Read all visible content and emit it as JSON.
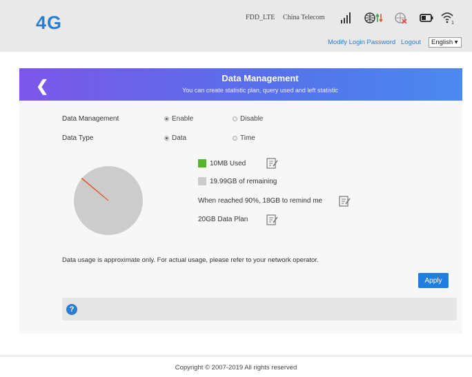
{
  "header": {
    "logo": "4G",
    "network_mode": "FDD_LTE",
    "operator": "China Telecom",
    "modify_password": "Modify Login Password",
    "logout": "Logout",
    "language": "English ▾"
  },
  "banner": {
    "title": "Data Management",
    "subtitle": "You can create statistic plan, query used and left statistic"
  },
  "form": {
    "data_management_label": "Data Management",
    "enable": "Enable",
    "disable": "Disable",
    "data_type_label": "Data Type",
    "data": "Data",
    "time": "Time"
  },
  "usage": {
    "used": "10MB Used",
    "remaining": "19.99GB of remaining",
    "reminder": "When reached 90%, 18GB to remind me",
    "plan": "20GB Data Plan"
  },
  "chart_data": {
    "type": "pie",
    "used_fraction": 0.0005
  },
  "note": "Data usage is approximate only. For actual usage, please refer to your network operator.",
  "apply": "Apply",
  "footer": "Copyright © 2007-2019 All rights reserved",
  "colors": {
    "used": "#57b52a",
    "remaining": "#cccccc",
    "accent": "#2a7dd1",
    "gradient_start": "#7c56e9",
    "gradient_end": "#4b89f0"
  }
}
